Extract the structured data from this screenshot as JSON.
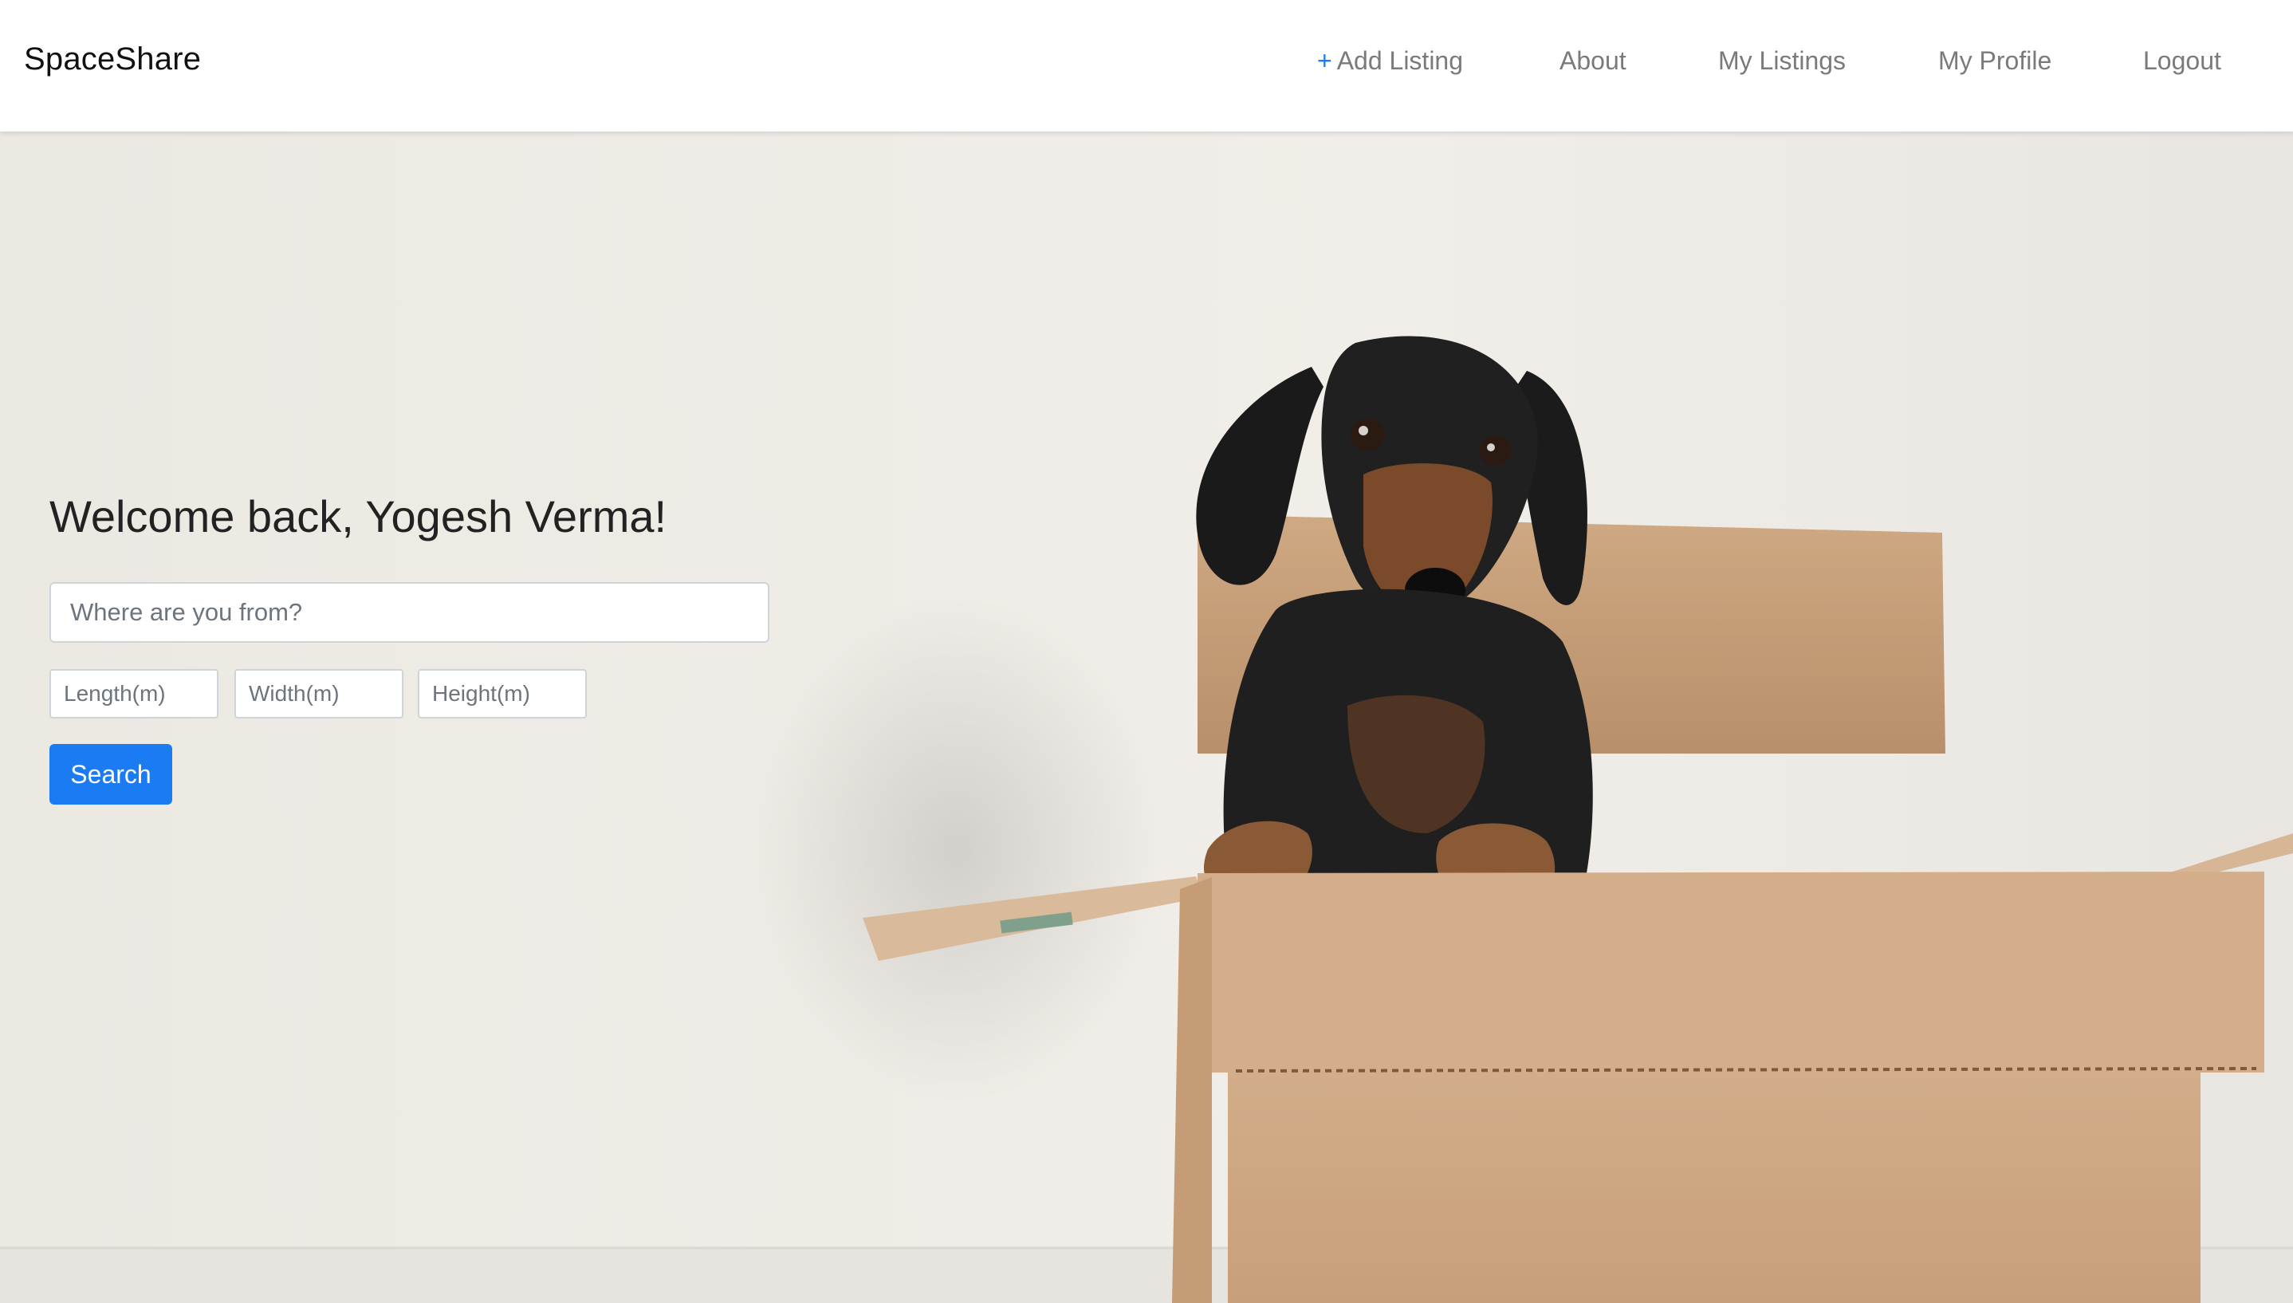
{
  "brand": "SpaceShare",
  "nav": {
    "add_plus": "+",
    "add_listing": "Add Listing",
    "about": "About",
    "my_listings": "My Listings",
    "my_profile": "My Profile",
    "logout": "Logout"
  },
  "hero": {
    "welcome": "Welcome back, Yogesh Verma!",
    "location_placeholder": "Where are you from?",
    "length_placeholder": "Length(m)",
    "width_placeholder": "Width(m)",
    "height_placeholder": "Height(m)",
    "search_label": "Search",
    "image_subject": "dachshund-in-cardboard-box"
  },
  "colors": {
    "accent": "#1a7bf2",
    "nav_text": "#7a7a7a",
    "background": "#efebe6"
  }
}
